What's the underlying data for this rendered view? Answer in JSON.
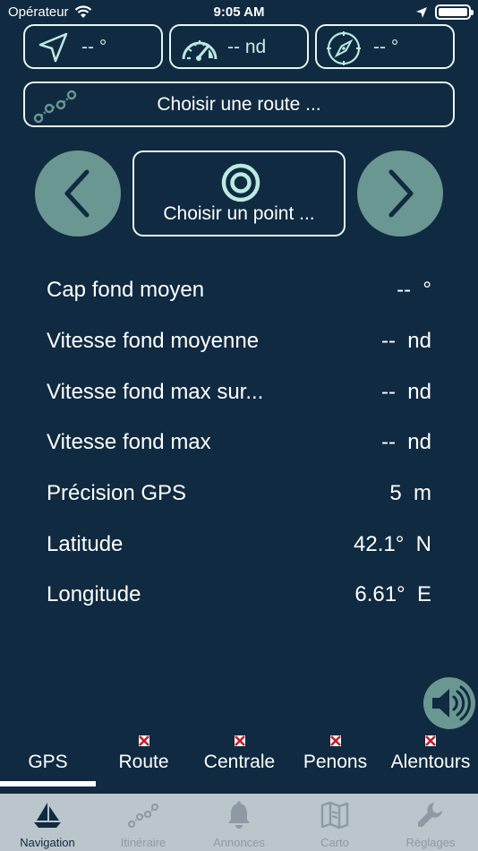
{
  "status_bar": {
    "carrier": "Opérateur",
    "time": "9:05 AM"
  },
  "top_stats": {
    "heading": "-- °",
    "speed": "-- nd",
    "compass": "-- °"
  },
  "route_button": {
    "label": "Choisir une route ..."
  },
  "point_button": {
    "label": "Choisir un point ..."
  },
  "rows": [
    {
      "label": "Cap fond moyen",
      "value": "--  °"
    },
    {
      "label": "Vitesse fond moyenne",
      "value": "--  nd"
    },
    {
      "label": "Vitesse fond max sur...",
      "value": "--  nd"
    },
    {
      "label": "Vitesse fond max",
      "value": "--  nd"
    },
    {
      "label": "Précision GPS",
      "value": "5  m"
    },
    {
      "label": "Latitude",
      "value": "42.1°  N"
    },
    {
      "label": "Longitude",
      "value": "6.61°  E"
    }
  ],
  "segment_tabs": [
    {
      "label": "GPS",
      "active": true
    },
    {
      "label": "Route",
      "active": false
    },
    {
      "label": "Centrale",
      "active": false
    },
    {
      "label": "Penons",
      "active": false
    },
    {
      "label": "Alentours",
      "active": false
    }
  ],
  "tab_bar": [
    {
      "label": "Navigation",
      "icon": "sailboat-icon",
      "active": true
    },
    {
      "label": "Itinéraire",
      "icon": "route-icon",
      "active": false
    },
    {
      "label": "Annonces",
      "icon": "bell-icon",
      "active": false
    },
    {
      "label": "Carto",
      "icon": "map-icon",
      "active": false
    },
    {
      "label": "Réglages",
      "icon": "wrench-icon",
      "active": false
    }
  ],
  "colors": {
    "background": "#0f2a41",
    "accent": "#6a9791",
    "icon_mint": "#b9ebdf",
    "tab_bar_bg": "#bac5cc",
    "flag_red": "#c0202a"
  }
}
